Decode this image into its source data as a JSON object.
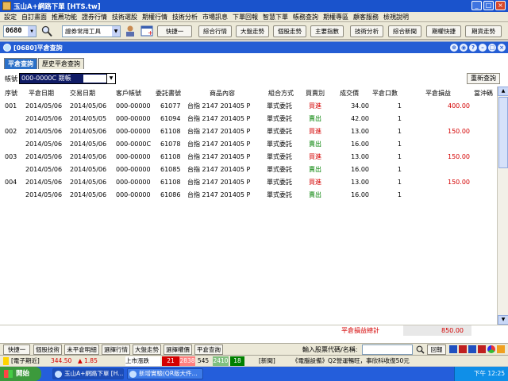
{
  "window": {
    "title": "玉山A+網路下單 [HTS.tw]"
  },
  "menu": [
    "設定",
    "自訂畫面",
    "推薦功能",
    "證券行情",
    "技術選股",
    "期權行情",
    "技術分析",
    "市場訊息",
    "下單回報",
    "智慧下單",
    "帳務查詢",
    "期權專區",
    "顧客服務",
    "檢視說明"
  ],
  "toolbar": {
    "stock_code": "0680",
    "tool_select": "證券常用工具",
    "buttons": [
      "快捷一",
      "綜合行情",
      "大盤走勢",
      "個股走勢",
      "主要指數",
      "技術分析",
      "綜合新聞",
      "期權快捷",
      "期貨走勢"
    ]
  },
  "panel": {
    "title": "[0680]平倉查詢",
    "tabs": [
      "平倉查詢",
      "歷史平倉查詢"
    ],
    "account_label": "帳號",
    "account_value": "000-0000C  期帳",
    "refresh_label": "重新查詢",
    "columns": [
      "序號",
      "平倉日期",
      "交易日期",
      "客戶帳號",
      "委託書號",
      "商品內容",
      "組合方式",
      "買賣別",
      "成交價",
      "平倉口數",
      "平倉損益",
      "當沖碼"
    ],
    "rows": [
      {
        "seq": "001",
        "close_date": "2014/05/06",
        "trade_date": "2014/05/06",
        "account": "000-00000",
        "order_no": "61077",
        "product": "台指 2147 201405 P",
        "combo": "單式委託",
        "side": "買進",
        "side_type": "buy",
        "price": "34.00",
        "qty": "1",
        "pnl": "400.00"
      },
      {
        "seq": "",
        "close_date": "2014/05/06",
        "trade_date": "2014/05/05",
        "account": "000-00000",
        "order_no": "61094",
        "product": "台指 2147 201405 P",
        "combo": "單式委託",
        "side": "賣出",
        "side_type": "sell",
        "price": "42.00",
        "qty": "1",
        "pnl": ""
      },
      {
        "seq": "002",
        "close_date": "2014/05/06",
        "trade_date": "2014/05/06",
        "account": "000-00000",
        "order_no": "61108",
        "product": "台指 2147 201405 P",
        "combo": "單式委託",
        "side": "買進",
        "side_type": "buy",
        "price": "13.00",
        "qty": "1",
        "pnl": "150.00"
      },
      {
        "seq": "",
        "close_date": "2014/05/06",
        "trade_date": "2014/05/06",
        "account": "000-0000C",
        "order_no": "61078",
        "product": "台指 2147 201405 P",
        "combo": "單式委託",
        "side": "賣出",
        "side_type": "sell",
        "price": "16.00",
        "qty": "1",
        "pnl": ""
      },
      {
        "seq": "003",
        "close_date": "2014/05/06",
        "trade_date": "2014/05/06",
        "account": "000-00000",
        "order_no": "61108",
        "product": "台指 2147 201405 P",
        "combo": "單式委託",
        "side": "買進",
        "side_type": "buy",
        "price": "13.00",
        "qty": "1",
        "pnl": "150.00"
      },
      {
        "seq": "",
        "close_date": "2014/05/06",
        "trade_date": "2014/05/06",
        "account": "000-00000",
        "order_no": "61085",
        "product": "台指 2147 201405 P",
        "combo": "單式委託",
        "side": "賣出",
        "side_type": "sell",
        "price": "16.00",
        "qty": "1",
        "pnl": ""
      },
      {
        "seq": "004",
        "close_date": "2014/05/06",
        "trade_date": "2014/05/06",
        "account": "000-00000",
        "order_no": "61108",
        "product": "台指 2147 201405 P",
        "combo": "單式委託",
        "side": "買進",
        "side_type": "buy",
        "price": "13.00",
        "qty": "1",
        "pnl": "150.00"
      },
      {
        "seq": "",
        "close_date": "2014/05/06",
        "trade_date": "2014/05/06",
        "account": "000-00000",
        "order_no": "61086",
        "product": "台指 2147 201405 P",
        "combo": "單式委託",
        "side": "賣出",
        "side_type": "sell",
        "price": "16.00",
        "qty": "1",
        "pnl": ""
      }
    ],
    "total_label": "平倉損益總計",
    "total_value": "850.00"
  },
  "bottom": {
    "buttons": [
      "快捷一",
      "個股技術",
      "未平倉明細",
      "選擇行情",
      "大盤走勢",
      "選擇權價",
      "平倉查詢"
    ],
    "input_label": "輸入股票代碼/名稱:",
    "report_label": "回報"
  },
  "ticker": {
    "futures_label": "[電子期近]",
    "futures_price": "344.50",
    "futures_change": "▲ 1.85",
    "market_label": "上市漲跌",
    "up": "21",
    "down_count": "2838",
    "flat": "545",
    "up2": "2410",
    "down2": "18",
    "news_label": "[新聞]",
    "news_text": "《電腦設備》Q2營運暢旺，事欣科收復50元"
  },
  "taskbar": {
    "start_label": "開始",
    "tasks": [
      "玉山A+網路下單 [H...",
      "新增實驗(QR版大件..."
    ],
    "clock": "下午 12:25"
  },
  "colors": {
    "title_blue": "#1a53cc",
    "buy_red": "#d40000",
    "sell_green": "#008000"
  }
}
